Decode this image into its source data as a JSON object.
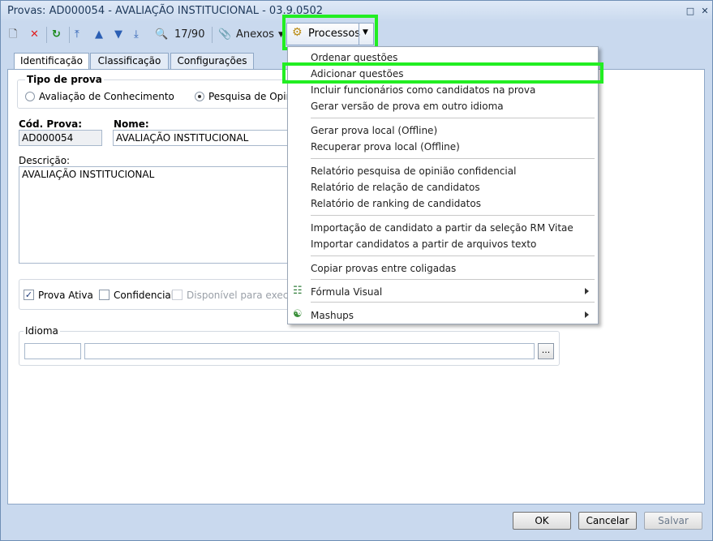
{
  "window": {
    "title": "Provas: AD000054 - AVALIAÇÃO INSTITUCIONAL - 03.9.0502"
  },
  "toolbar": {
    "counter": "17/90",
    "anexos": "Anexos",
    "processos": "Processos"
  },
  "tabs": [
    "Identificação",
    "Classificação",
    "Configurações"
  ],
  "form": {
    "tipo_prova_label": "Tipo de prova",
    "radio_conhecimento": "Avaliação de Conhecimento",
    "radio_pesquisa": "Pesquisa de Opiniã",
    "cod_label": "Cód. Prova:",
    "cod_value": "AD000054",
    "nome_label": "Nome:",
    "nome_value": "AVALIAÇÃO INSTITUCIONAL",
    "descricao_label": "Descrição:",
    "descricao_value": "AVALIAÇÃO INSTITUCIONAL",
    "prova_ativa": "Prova Ativa",
    "confidencial": "Confidencial",
    "disponivel": "Disponível para execuçã",
    "idioma_label": "Idioma",
    "browse": "..."
  },
  "menu": {
    "items": [
      "Ordenar questões",
      "Adicionar questões",
      "Incluir funcionários como candidatos na prova",
      "Gerar versão de prova em outro idioma",
      "Gerar prova local (Offline)",
      "Recuperar prova local (Offline)",
      "Relatório pesquisa de opinião confidencial",
      "Relatório de relação de candidatos",
      "Relatório de ranking de candidatos",
      "Importação de candidato a partir da seleção RM Vitae",
      "Importar candidatos a partir de arquivos texto",
      "Copiar provas entre coligadas",
      "Fórmula Visual",
      "Mashups"
    ]
  },
  "buttons": {
    "ok": "OK",
    "cancel": "Cancelar",
    "save": "Salvar"
  },
  "colors": {
    "highlight": "#22ee22",
    "window_bg": "#c9d9ee"
  }
}
